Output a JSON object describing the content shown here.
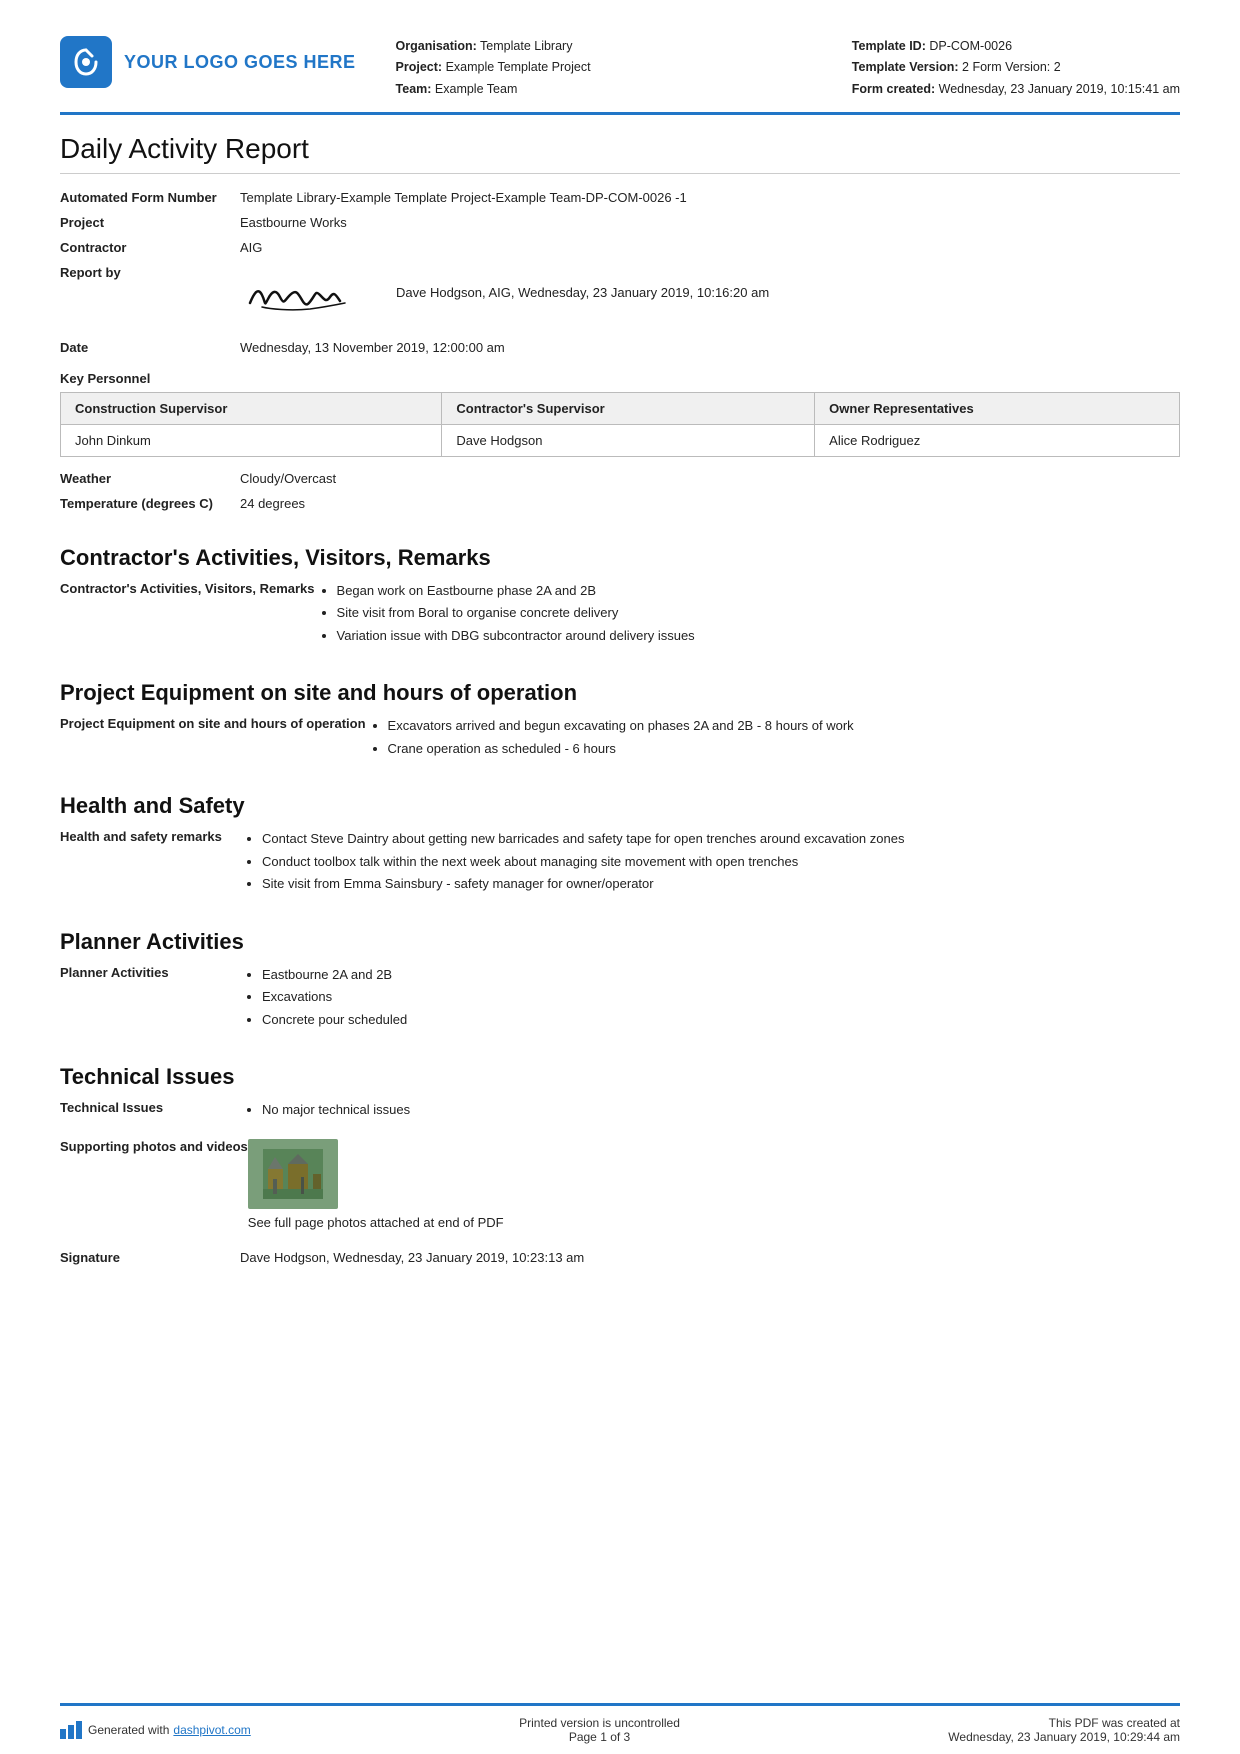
{
  "header": {
    "logo_text": "YOUR LOGO GOES HERE",
    "organisation_label": "Organisation:",
    "organisation_value": "Template Library",
    "project_label": "Project:",
    "project_value": "Example Template Project",
    "team_label": "Team:",
    "team_value": "Example Team",
    "template_id_label": "Template ID:",
    "template_id_value": "DP-COM-0026",
    "template_version_label": "Template Version:",
    "template_version_value": "2 Form Version: 2",
    "form_created_label": "Form created:",
    "form_created_value": "Wednesday, 23 January 2019, 10:15:41 am"
  },
  "report": {
    "title": "Daily Activity Report",
    "automated_form_number_label": "Automated Form Number",
    "automated_form_number_value": "Template Library-Example Template Project-Example Team-DP-COM-0026   -1",
    "project_label": "Project",
    "project_value": "Eastbourne Works",
    "contractor_label": "Contractor",
    "contractor_value": "AIG",
    "report_by_label": "Report by",
    "report_by_value": "Dave Hodgson, AIG, Wednesday, 23 January 2019, 10:16:20 am",
    "date_label": "Date",
    "date_value": "Wednesday, 13 November 2019, 12:00:00 am"
  },
  "key_personnel": {
    "label": "Key Personnel",
    "columns": [
      "Construction Supervisor",
      "Contractor's Supervisor",
      "Owner Representatives"
    ],
    "row": [
      "John Dinkum",
      "Dave Hodgson",
      "Alice Rodriguez"
    ]
  },
  "weather": {
    "label": "Weather",
    "value": "Cloudy/Overcast"
  },
  "temperature": {
    "label": "Temperature (degrees C)",
    "value": "24 degrees"
  },
  "contractors_activities": {
    "heading": "Contractor's Activities, Visitors, Remarks",
    "label": "Contractor's Activities, Visitors, Remarks",
    "items": [
      "Began work on Eastbourne phase 2A and 2B",
      "Site visit from Boral to organise concrete delivery",
      "Variation issue with DBG subcontractor around delivery issues"
    ]
  },
  "project_equipment": {
    "heading": "Project Equipment on site and hours of operation",
    "label": "Project Equipment on site and hours of operation",
    "items": [
      "Excavators arrived and begun excavating on phases 2A and 2B - 8 hours of work",
      "Crane operation as scheduled - 6 hours"
    ]
  },
  "health_safety": {
    "heading": "Health and Safety",
    "label": "Health and safety remarks",
    "items": [
      "Contact Steve Daintry about getting new barricades and safety tape for open trenches around excavation zones",
      "Conduct toolbox talk within the next week about managing site movement with open trenches",
      "Site visit from Emma Sainsbury - safety manager for owner/operator"
    ]
  },
  "planner_activities": {
    "heading": "Planner Activities",
    "label": "Planner Activities",
    "items": [
      "Eastbourne 2A and 2B",
      "Excavations",
      "Concrete pour scheduled"
    ]
  },
  "technical_issues": {
    "heading": "Technical Issues",
    "label": "Technical Issues",
    "items": [
      "No major technical issues"
    ],
    "supporting_photos_label": "Supporting photos and videos",
    "supporting_photos_caption": "See full page photos attached at end of PDF",
    "signature_label": "Signature",
    "signature_value": "Dave Hodgson, Wednesday, 23 January 2019, 10:23:13 am"
  },
  "footer": {
    "generated_text": "Generated with ",
    "dashpivot_link": "dashpivot.com",
    "uncontrolled_text": "Printed version is uncontrolled",
    "page_text": "Page 1 of 3",
    "pdf_created_text": "This PDF was created at",
    "pdf_created_date": "Wednesday, 23 January 2019, 10:29:44 am"
  }
}
